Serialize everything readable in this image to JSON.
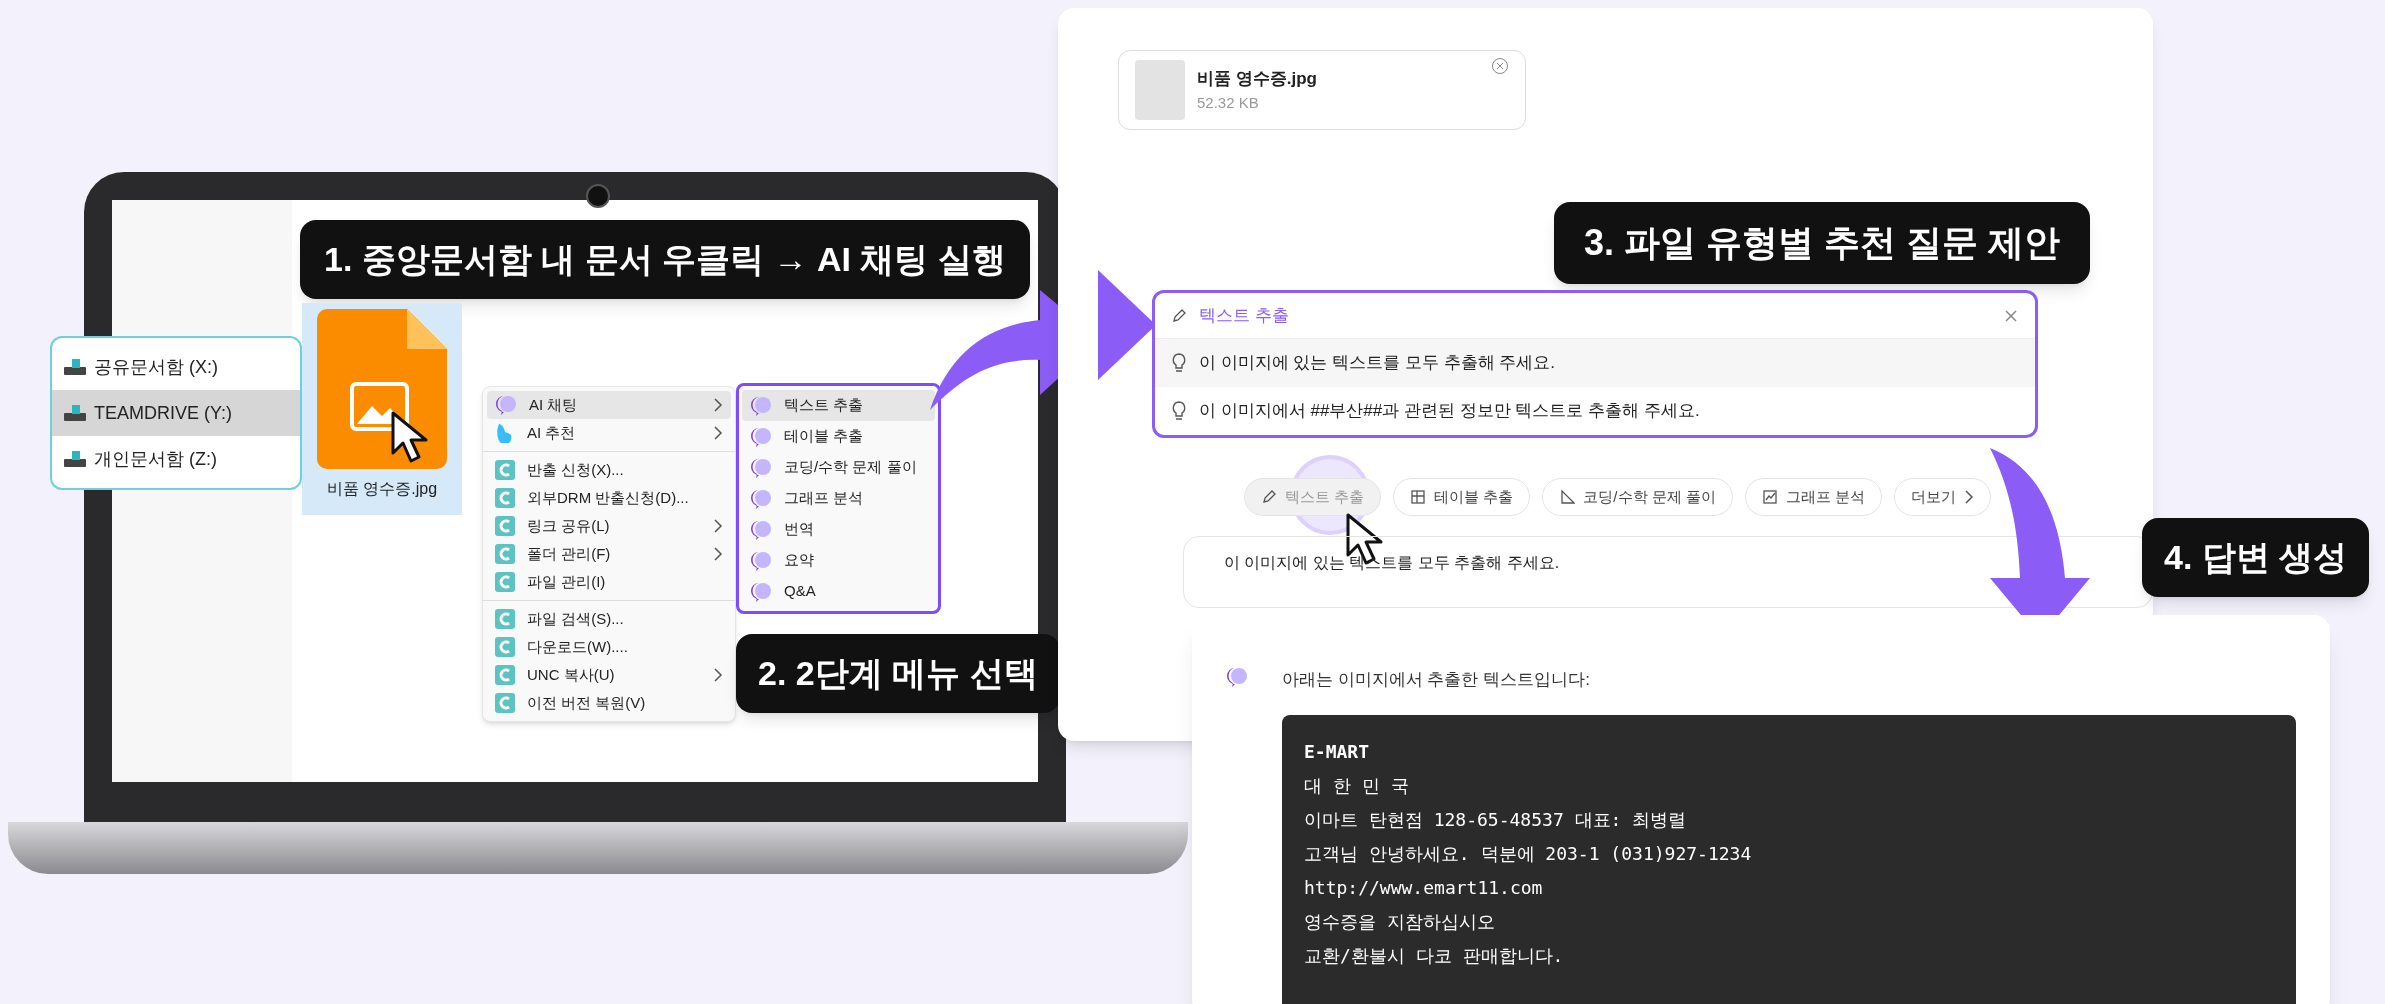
{
  "callouts": [
    "1. 중앙문서함 내 문서 우클릭 → AI 채팅 실행",
    "2. 2단계 메뉴 선택",
    "3. 파일 유형별 추천 질문 제안",
    "4. 답변 생성"
  ],
  "drives": [
    {
      "label": "공유문서함 (X:)",
      "selected": false
    },
    {
      "label": "TEAMDRIVE (Y:)",
      "selected": true
    },
    {
      "label": "개인문서함 (Z:)",
      "selected": false
    }
  ],
  "file": {
    "name": "비품 영수증.jpg",
    "selected": true
  },
  "context_menu": [
    {
      "kind": "ai",
      "label": "AI 채팅",
      "submenu": true,
      "selected": true
    },
    {
      "kind": "recommend",
      "label": "AI 추천",
      "submenu": true,
      "selected": false
    },
    {
      "kind": "separator"
    },
    {
      "kind": "app",
      "label": "반출 신청(X)...",
      "submenu": false,
      "selected": false
    },
    {
      "kind": "app",
      "label": "외부DRM 반출신청(D)...",
      "submenu": false,
      "selected": false
    },
    {
      "kind": "app",
      "label": "링크 공유(L)",
      "submenu": true,
      "selected": false
    },
    {
      "kind": "app",
      "label": "폴더 관리(F)",
      "submenu": true,
      "selected": false
    },
    {
      "kind": "app",
      "label": "파일 관리(I)",
      "submenu": false,
      "selected": false
    },
    {
      "kind": "separator"
    },
    {
      "kind": "app",
      "label": "파일 검색(S)...",
      "submenu": false,
      "selected": false
    },
    {
      "kind": "app",
      "label": "다운로드(W)....",
      "submenu": false,
      "selected": false
    },
    {
      "kind": "app",
      "label": "UNC 복사(U)",
      "submenu": true,
      "selected": false
    },
    {
      "kind": "app",
      "label": "이전 버전 복원(V)",
      "submenu": false,
      "selected": false
    }
  ],
  "submenu": [
    {
      "label": "텍스트 추출",
      "selected": true
    },
    {
      "label": "테이블 추출",
      "selected": false
    },
    {
      "label": "코딩/수학 문제 풀이",
      "selected": false
    },
    {
      "label": "그래프 분석",
      "selected": false
    },
    {
      "label": "번역",
      "selected": false
    },
    {
      "label": "요약",
      "selected": false
    },
    {
      "label": "Q&A",
      "selected": false
    }
  ],
  "chat": {
    "attachment": {
      "name": "비품 영수증.jpg",
      "size": "52.32 KB"
    },
    "suggestions": {
      "title": "텍스트 추출",
      "items": [
        "이 이미지에 있는 텍스트를 모두 추출해 주세요.",
        "이 이미지에서 ##부산##과 관련된 정보만 텍스트로 추출해 주세요."
      ]
    },
    "chips": [
      {
        "kind": "pencil",
        "label": "텍스트 추출",
        "selected": true
      },
      {
        "kind": "table",
        "label": "테이블 추출",
        "selected": false
      },
      {
        "kind": "ruler",
        "label": "코딩/수학 문제 풀이",
        "selected": false
      },
      {
        "kind": "chart",
        "label": "그래프 분석",
        "selected": false
      },
      {
        "kind": "more",
        "label": "더보기",
        "selected": false
      }
    ],
    "input_value": "이 이미지에 있는 텍스트를 모두 추출해 주세요."
  },
  "answer": {
    "intro": "아래는 이미지에서 추출한 텍스트입니다:",
    "code_lines": [
      "E-MART",
      "대 한 민 국",
      "이마트 탄현점 128-65-48537 대표: 최병렬",
      "고객님 안녕하세요. 덕분에 203-1 (031)927-1234",
      "http://www.emart11.com",
      "영수증을 지참하십시오",
      "교환/환불시 다코 판매합니다."
    ]
  }
}
